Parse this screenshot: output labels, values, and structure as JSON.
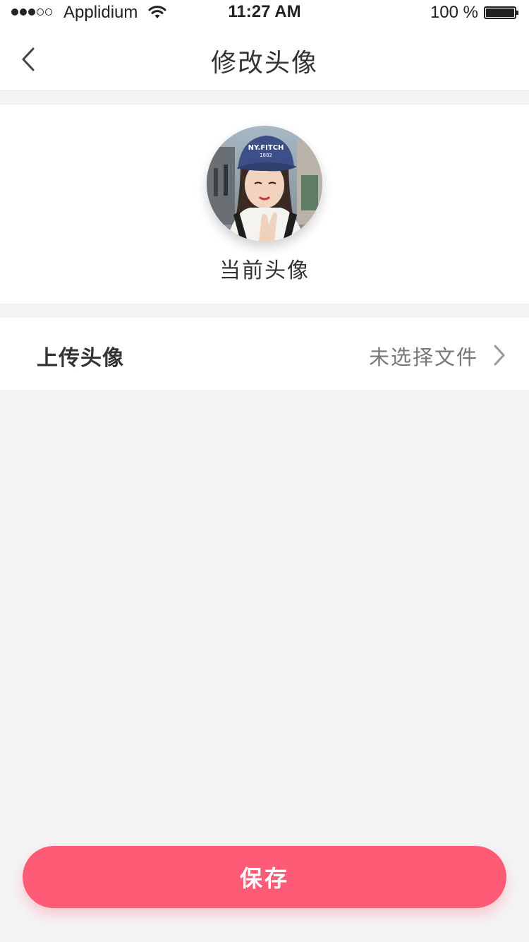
{
  "status_bar": {
    "carrier": "Applidium",
    "time": "11:27 AM",
    "battery": "100 %",
    "signal_strength_dots": 3,
    "signal_total_dots": 5,
    "battery_level": 1.0
  },
  "nav": {
    "title": "修改头像",
    "back_icon": "chevron-left-icon"
  },
  "avatar": {
    "caption": "当前头像"
  },
  "upload": {
    "label": "上传头像",
    "value": "未选择文件",
    "icon": "chevron-right-icon"
  },
  "save": {
    "label": "保存"
  },
  "colors": {
    "accent": "#fe5b77",
    "background": "#f4f4f4",
    "card": "#ffffff",
    "text_primary": "#333333",
    "text_secondary": "#777777"
  }
}
